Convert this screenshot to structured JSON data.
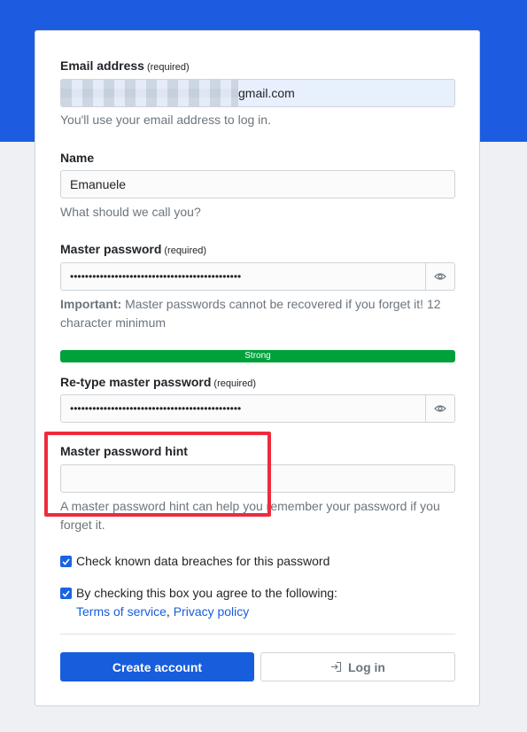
{
  "form": {
    "email": {
      "label": "Email address",
      "required_tag": "(required)",
      "value_visible": "gmail.com",
      "help": "You'll use your email address to log in."
    },
    "name": {
      "label": "Name",
      "value": "Emanuele",
      "help": "What should we call you?"
    },
    "master_password": {
      "label": "Master password",
      "required_tag": "(required)",
      "value_masked": "••••••••••••••••••••••••••••••••••••••••••••••",
      "help_bold": "Important:",
      "help_text": " Master passwords cannot be recovered if you forget it! 12 character minimum",
      "strength_label": "Strong",
      "strength_fraction": 1.0
    },
    "retype_password": {
      "label": "Re-type master password",
      "required_tag": "(required)",
      "value_masked": "••••••••••••••••••••••••••••••••••••••••••••••"
    },
    "hint": {
      "label": "Master password hint",
      "value": "",
      "help": "A master password hint can help you remember your password if you forget it."
    },
    "check_breaches": {
      "label": "Check known data breaches for this password",
      "checked": true
    },
    "terms": {
      "label": "By checking this box you agree to the following:",
      "checked": true,
      "terms_link": "Terms of service",
      "separator": ",",
      "privacy_link": "Privacy policy"
    },
    "create_button": "Create account",
    "login_button": "Log in"
  },
  "colors": {
    "brand": "#175ddc",
    "strength_good": "#00a13b",
    "highlight": "#ee2b3d"
  },
  "icons": [
    "eye-icon",
    "checkmark-icon",
    "sign-in-icon"
  ]
}
